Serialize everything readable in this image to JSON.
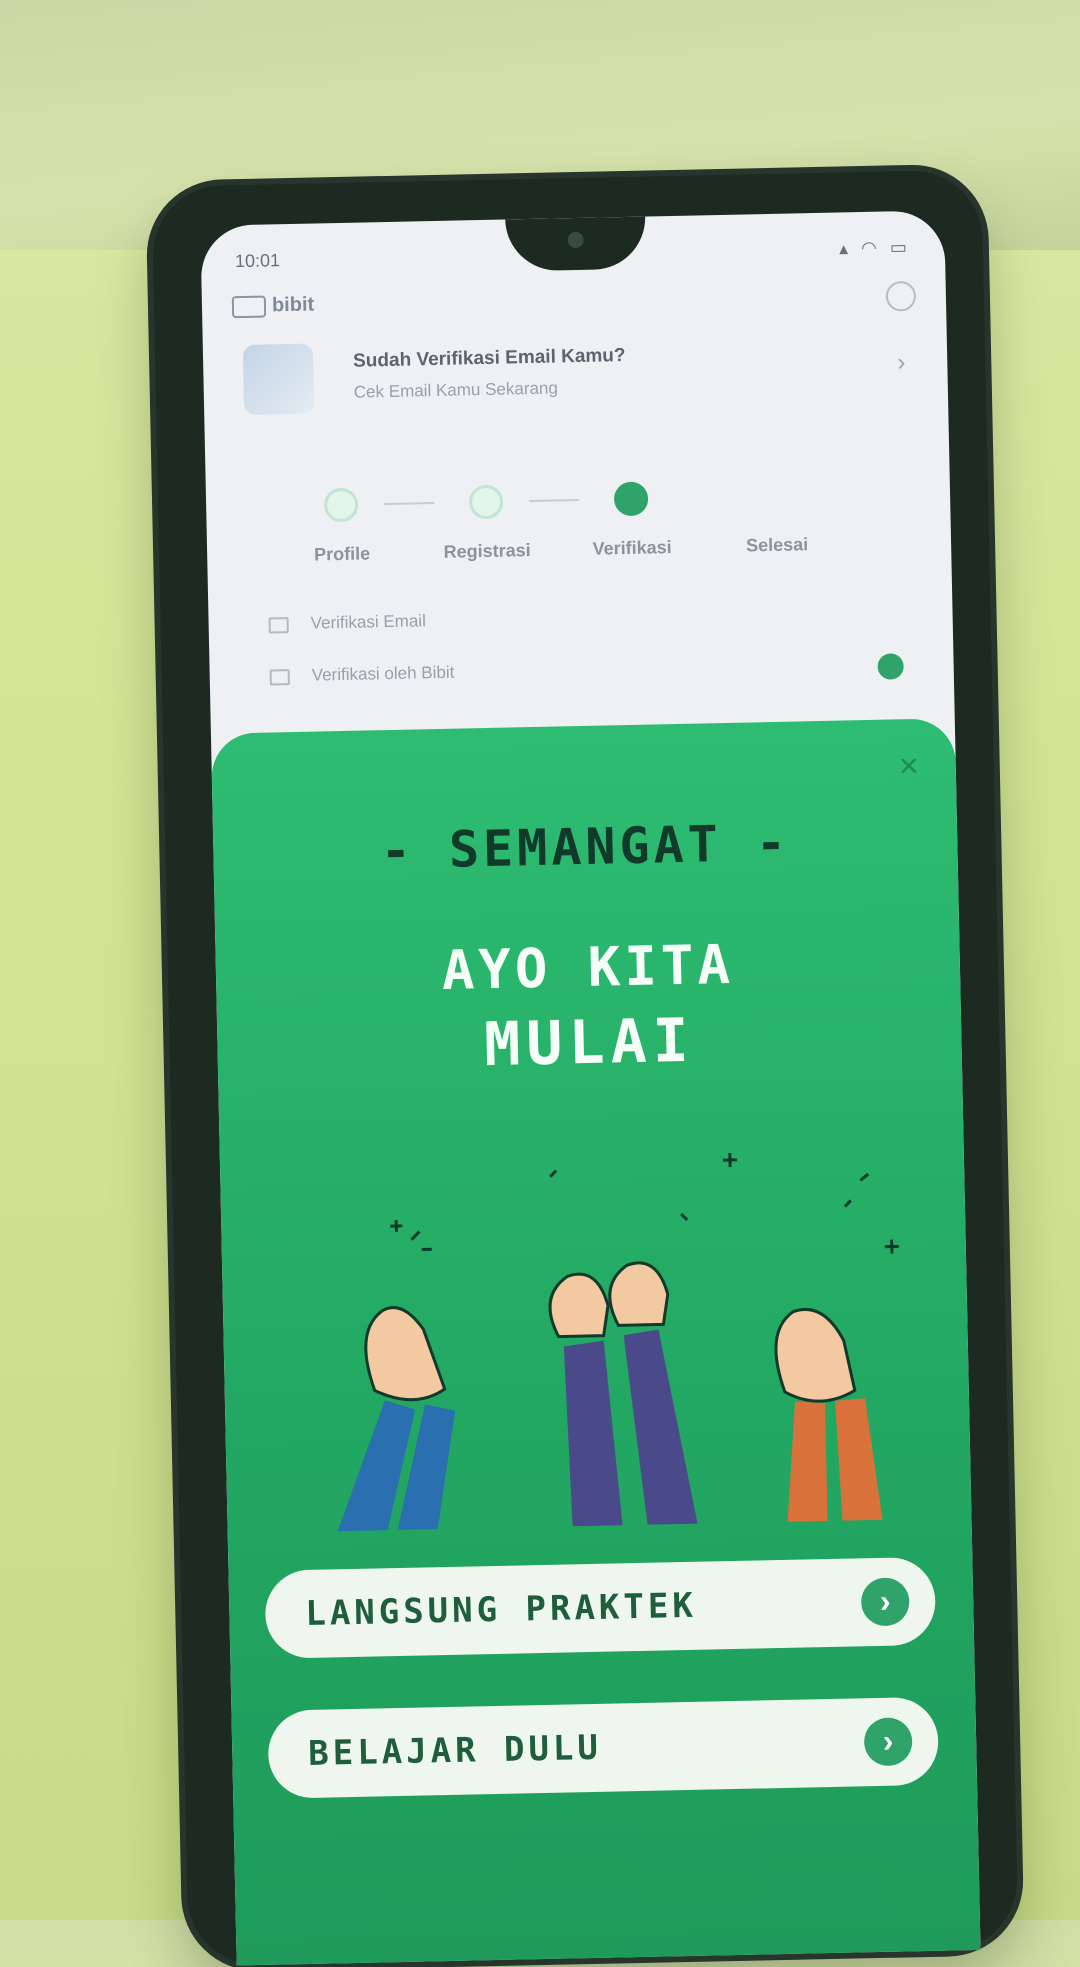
{
  "status_bar": {
    "time": "10:01",
    "icons": "▴ ◠ ▭"
  },
  "app": {
    "logo": "bibit"
  },
  "banner": {
    "title": "Sudah Verifikasi Email Kamu?",
    "subtitle": "Cek Email Kamu Sekarang"
  },
  "stepper": {
    "steps": [
      {
        "label": "Profile",
        "active": false
      },
      {
        "label": "Registrasi",
        "active": false
      },
      {
        "label": "Verifikasi",
        "active": true
      },
      {
        "label": "Selesai",
        "active": false
      }
    ]
  },
  "verification": {
    "items": [
      {
        "label": "Verifikasi Email"
      },
      {
        "label": "Verifikasi oleh Bibit"
      }
    ]
  },
  "sheet": {
    "headline": "- SEMANGAT -",
    "line1": "AYO KITA",
    "line2": "MULAI",
    "primary_cta": "LANGSUNG PRAKTEK",
    "secondary_cta": "BELAJAR DULU",
    "arrow": "›"
  },
  "colors": {
    "accent": "#2fa36a",
    "sheet_bg": "#24ad66"
  }
}
